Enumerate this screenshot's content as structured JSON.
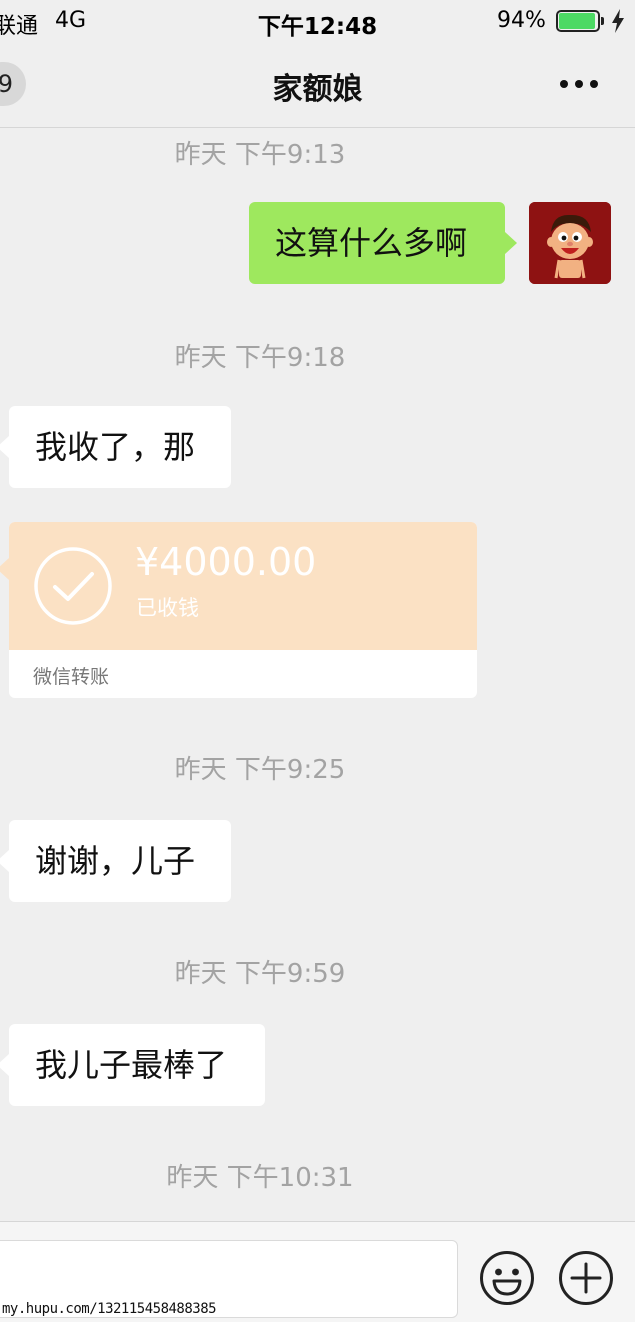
{
  "status_bar": {
    "carrier": "联通",
    "network": "4G",
    "time": "下午12:48",
    "battery_percent": "94%",
    "battery_level": 0.94,
    "icons": [
      "battery-icon",
      "charging-bolt-icon"
    ]
  },
  "nav": {
    "back_badge": "9",
    "title": "家额娘",
    "more_icon": "more-dots-icon"
  },
  "messages": {
    "ts1": "昨天 下午9:13",
    "out1": "这算什么多啊",
    "ts2": "昨天 下午9:18",
    "in1": "我收了，那",
    "transfer": {
      "amount": "¥4000.00",
      "status": "已收钱",
      "label": "微信转账",
      "icon": "check-circle-icon"
    },
    "ts3": "昨天 下午9:25",
    "in2": "谢谢，儿子",
    "ts4": "昨天 下午9:59",
    "in3": "我儿子最棒了",
    "ts5": "昨天 下午10:31"
  },
  "input_bar": {
    "value": "",
    "emoji_icon": "smile-emoji-icon",
    "plus_icon": "plus-circle-icon"
  },
  "watermark": "my.hupu.com/132115458488385",
  "colors": {
    "background": "#efefef",
    "outgoing_bubble": "#9ee85e",
    "incoming_bubble": "#ffffff",
    "transfer_card": "#fbe1c4",
    "timestamp": "#a3a3a3",
    "battery_green": "#4cd964"
  }
}
